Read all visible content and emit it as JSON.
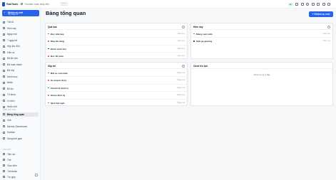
{
  "app": {
    "name": "TaskTools"
  },
  "search": {
    "placeholder": "Tìm kiếm hoặc nhảy đến",
    "shortcut": "Ctrl K"
  },
  "topbar": {
    "badge": "Vip"
  },
  "sidebar": {
    "new_button": {
      "label": "Nhiệm vụ mới",
      "sublabel": "Tạo nhiệm vụ"
    },
    "items": [
      {
        "label": "Tất cả"
      },
      {
        "label": "Hôm nay"
      },
      {
        "label": "Ngày mai"
      },
      {
        "label": "7 ngày tới"
      },
      {
        "label": "Hộp thư đến"
      },
      {
        "label": "Gắn cờ"
      },
      {
        "label": "Đã lên lịch"
      },
      {
        "label": "Đã hoàn thành"
      },
      {
        "label": "Đã hủy"
      },
      {
        "label": "Danh mục"
      },
      {
        "label": "Nhãn"
      },
      {
        "label": "Bộ lọc"
      },
      {
        "label": "Từ khóa"
      },
      {
        "label": "Ưu tiên"
      },
      {
        "label": "Nhắc nhở"
      }
    ],
    "section_label": "CHẾ ĐỘ XEM",
    "views": [
      {
        "label": "Bảng tổng quan"
      },
      {
        "label": "Lịch"
      },
      {
        "label": "Ma trận Eisenhower"
      },
      {
        "label": "Kanban"
      },
      {
        "label": "Dòng thời gian"
      }
    ],
    "section2_label": "CÀI ĐẶT",
    "settings": [
      {
        "label": "Tiện ích"
      },
      {
        "label": "Thẻ"
      },
      {
        "label": "Giao diện"
      },
      {
        "label": "Tài khoản"
      }
    ],
    "bottom": {
      "label": "Trợ giúp"
    }
  },
  "main": {
    "title": "Bảng tổng quan",
    "create_button": "+ Nhiệm vụ mới"
  },
  "cards": {
    "overdue": {
      "title": "Quá hạn",
      "tasks": [
        {
          "name": "Đọc nhà bếp",
          "time": "Hôm nay",
          "color": "#ef4444"
        },
        {
          "name": "Mua đồ dùng",
          "time": "Hôm nay",
          "color": "#ef4444"
        },
        {
          "name": "Đánh xanh đọc",
          "time": "Hôm nay",
          "color": "#1f2937"
        },
        {
          "name": "Đọc 30 phút",
          "time": "Hôm nay",
          "color": "#ef4444"
        }
      ]
    },
    "today": {
      "title": "Hôm nay",
      "tasks": [
        {
          "name": "Mang cuối tuần",
          "time": "Hôm nay",
          "color": "#ef4444"
        },
        {
          "name": "Giặt ga giường",
          "time": "Hôm nay",
          "color": "#1f2937"
        }
      ]
    },
    "upcoming": {
      "title": "Sắp tới",
      "tasks": [
        {
          "name": "Đặt xe cuối tuần",
          "time": "Ngày mai",
          "color": "#ef4444"
        },
        {
          "name": "Kế hoạch đi bộ",
          "time": "Ngày mai",
          "color": "#ef4444"
        },
        {
          "name": "Chuẩn bị hành lý",
          "time": "Ngày mai",
          "color": "#2563eb"
        },
        {
          "name": "Khám định kỳ",
          "time": "Ngày mai",
          "color": "#ef4444"
        },
        {
          "name": "Quà biết ngữ",
          "time": "Ngày mai",
          "color": "#ef4444"
        }
      ]
    },
    "unscheduled": {
      "title": "Chưa lên lịch",
      "empty": "Chưa có gì ở đây"
    }
  },
  "colors": {
    "accent": "#2563eb",
    "danger": "#ef4444"
  }
}
